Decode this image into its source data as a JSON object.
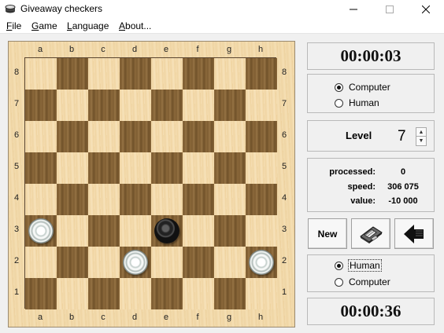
{
  "window": {
    "title": "Giveaway checkers"
  },
  "menu": [
    {
      "label": "File",
      "ul": "F",
      "rest": "ile"
    },
    {
      "label": "Game",
      "ul": "G",
      "rest": "ame"
    },
    {
      "label": "Language",
      "ul": "L",
      "rest": "anguage"
    },
    {
      "label": "About...",
      "ul": "A",
      "rest": "bout..."
    }
  ],
  "board": {
    "files": [
      "a",
      "b",
      "c",
      "d",
      "e",
      "f",
      "g",
      "h"
    ],
    "ranks": [
      "8",
      "7",
      "6",
      "5",
      "4",
      "3",
      "2",
      "1"
    ],
    "pieces": [
      {
        "square": "a3",
        "color": "white"
      },
      {
        "square": "e3",
        "color": "black"
      },
      {
        "square": "d2",
        "color": "white"
      },
      {
        "square": "h2",
        "color": "white"
      }
    ]
  },
  "top_player": {
    "clock": "00:00:03",
    "options": [
      {
        "label": "Computer",
        "checked": true
      },
      {
        "label": "Human",
        "checked": false
      }
    ]
  },
  "level": {
    "label": "Level",
    "value": "7"
  },
  "stats": [
    {
      "label": "processed:",
      "value": "0"
    },
    {
      "label": "speed:",
      "value": "306 075"
    },
    {
      "label": "value:",
      "value": "-10 000"
    }
  ],
  "buttons": {
    "new_label": "New",
    "save_icon": "floppy-disk-icon",
    "undo_icon": "back-arrow-icon"
  },
  "bottom_player": {
    "options": [
      {
        "label": "Human",
        "checked": true
      },
      {
        "label": "Computer",
        "checked": false
      }
    ],
    "clock": "00:00:36"
  }
}
